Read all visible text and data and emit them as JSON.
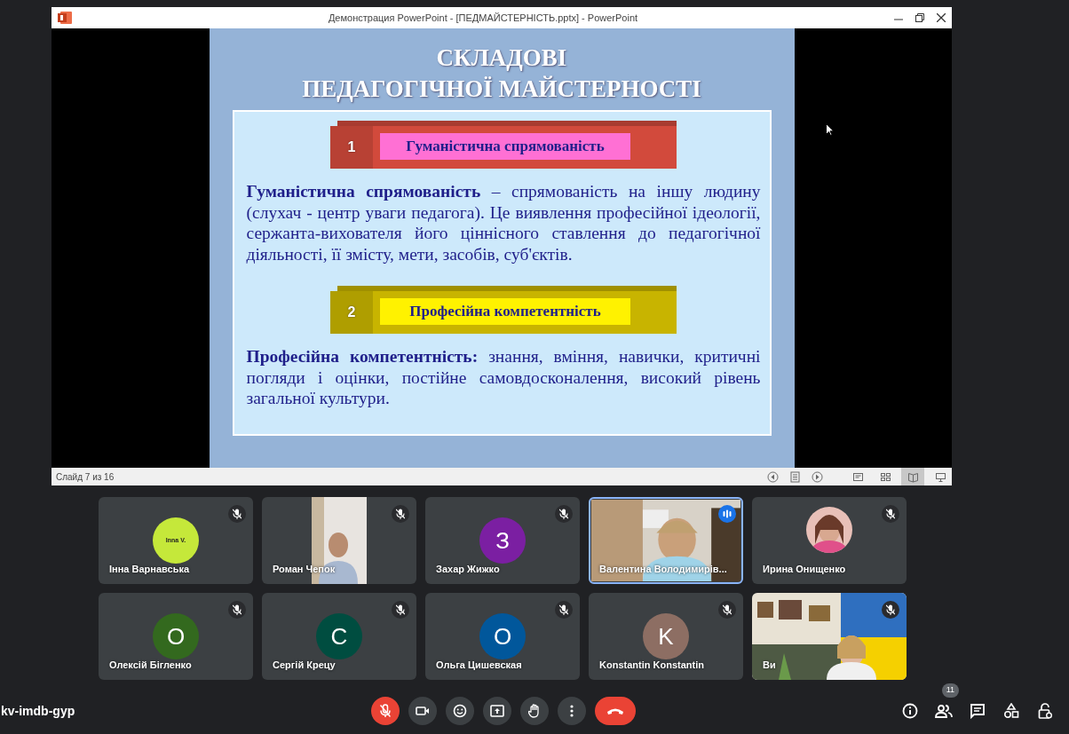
{
  "window": {
    "title": "Демонстрация PowerPoint - [ПЕДМАЙСТЕРНІСТЬ.pptx] - PowerPoint"
  },
  "slide": {
    "title_lines": [
      "СКЛАДОВІ",
      "ПЕДАГОГІЧНОЇ МАЙСТЕРНОСТІ"
    ],
    "sections": [
      {
        "number": "1",
        "label": "Гуманістична спрямованість",
        "color": "#d24a3c",
        "kind": "rose",
        "text": "**Гуманістична спрямованість** – спрямованість на іншу людину (слухач - центр уваги педагога). Це виявлення професійної ідеології, сержанта-вихователя його ціннісного ставлення до педагогічної діяльності, її змісту, мети, засобів, суб'єктів."
      },
      {
        "number": "2",
        "label": "Професійна компетентність",
        "color": "#c8b400",
        "kind": "lemon",
        "text": "**Професійна компетентність:** знання, вміння, навички, критичні погляди і оцінки, постійне самовдосконалення, високий рівень загальної культури."
      }
    ]
  },
  "status_bar": {
    "slide_counter": "Слайд 7 из 16",
    "view_buttons": [
      {
        "kind": "normal",
        "selected": false
      },
      {
        "kind": "sorter",
        "selected": false
      },
      {
        "kind": "reading",
        "selected": true
      },
      {
        "kind": "show",
        "selected": false
      }
    ]
  },
  "tiles": [
    {
      "name": "Інна Варнавська",
      "kind": "initial",
      "initial": "Inna V.",
      "color": "#c5e83a",
      "muted": true,
      "speaking": false
    },
    {
      "name": "Роман Чепок",
      "kind": "video",
      "muted": true,
      "speaking": false
    },
    {
      "name": "Захар Жижко",
      "kind": "initial",
      "initial": "З",
      "color": "#7b1fa2",
      "muted": true,
      "speaking": false
    },
    {
      "name": "Валентина Володимирів...",
      "kind": "video",
      "muted": false,
      "speaking": true
    },
    {
      "name": "Ирина Онищенко",
      "muted": true,
      "speaking": false
    },
    {
      "name": "Олексій Бігленко",
      "kind": "initial",
      "initial": "О",
      "color": "#33691e",
      "muted": true,
      "speaking": false
    },
    {
      "name": "Сергій Крецу",
      "kind": "initial",
      "initial": "С",
      "color": "#004d40",
      "muted": true,
      "speaking": false
    },
    {
      "name": "Ольга Цишевская",
      "kind": "initial",
      "initial": "О",
      "color": "#01579b",
      "muted": true,
      "speaking": false
    },
    {
      "name": "Konstantin Konstantin",
      "kind": "initial",
      "initial": "K",
      "color": "#8d6e63",
      "muted": true,
      "speaking": false
    },
    {
      "name": "Ви",
      "kind": "video",
      "muted": true,
      "speaking": false
    }
  ],
  "meeting_code": "kv-imdb-gyp",
  "controls": {
    "mic_on": false,
    "people_count": "11"
  }
}
